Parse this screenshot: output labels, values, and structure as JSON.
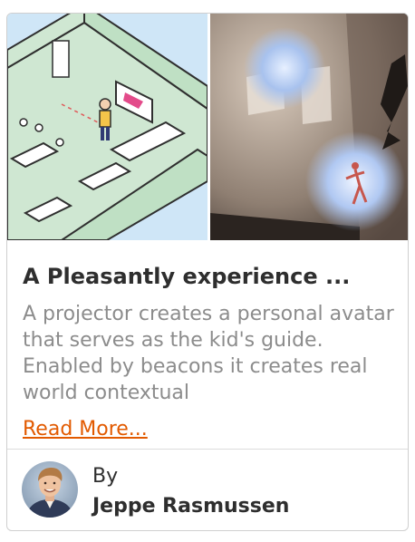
{
  "card": {
    "title": "A Pleasantly experience ...",
    "description": "A projector creates a personal avatar that serves as the kid's guide. Enabled by beacons it creates real world contextual",
    "read_more_label": "Read More...",
    "byline_prefix": "By",
    "author_name": "Jeppe Rasmussen"
  },
  "images": {
    "left_icon": "isometric-room-illustration",
    "right_icon": "projected-avatar-photo"
  },
  "colors": {
    "accent": "#e25a00",
    "title": "#2e2e2e",
    "description": "#8c8c8c"
  }
}
